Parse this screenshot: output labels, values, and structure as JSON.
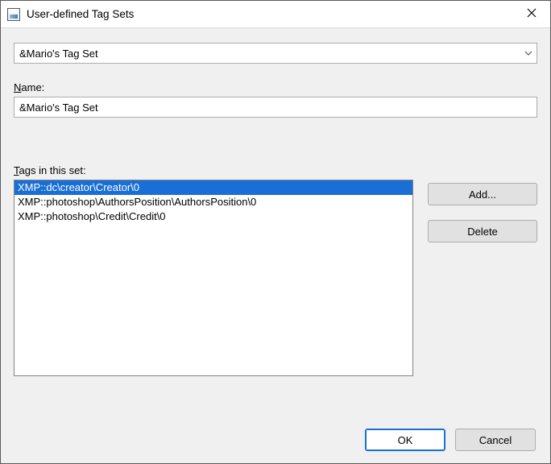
{
  "window": {
    "title": "User-defined Tag Sets"
  },
  "dropdown": {
    "value": "&Mario's Tag Set"
  },
  "name": {
    "label_prefix_underline": "N",
    "label_rest": "ame:",
    "value": "&Mario's Tag Set"
  },
  "tags": {
    "label_prefix_underline": "T",
    "label_rest": "ags in this set:",
    "items": [
      "XMP::dc\\creator\\Creator\\0",
      "XMP::photoshop\\AuthorsPosition\\AuthorsPosition\\0",
      "XMP::photoshop\\Credit\\Credit\\0"
    ],
    "selected_index": 0
  },
  "buttons": {
    "add": "Add...",
    "delete": "Delete",
    "ok": "OK",
    "cancel": "Cancel"
  }
}
